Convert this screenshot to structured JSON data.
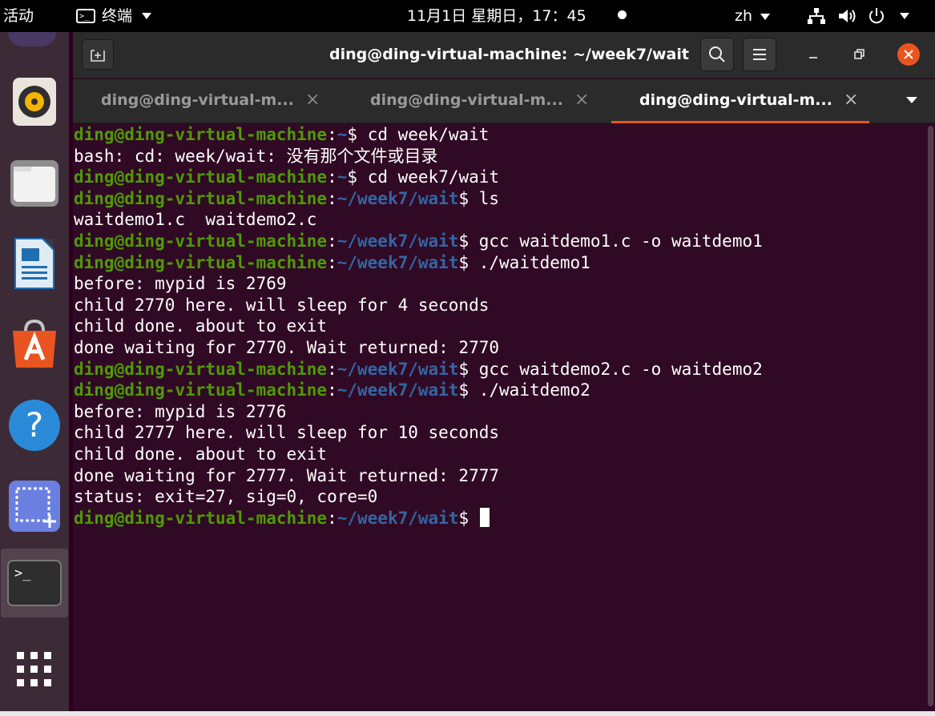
{
  "topbar": {
    "activities": "活动",
    "app_name": "终端",
    "clock": "11月1日 星期日，17：45",
    "language": "zh"
  },
  "dock": {
    "items": [
      "rhythmbox-icon",
      "files-icon",
      "libreoffice-writer-icon",
      "ubuntu-software-icon",
      "help-icon",
      "screenshot-icon",
      "terminal-icon",
      "show-apps-icon"
    ]
  },
  "window": {
    "title": "ding@ding-virtual-machine: ~/week7/wait",
    "tabs": [
      {
        "label": "ding@ding-virtual-m...",
        "close": "×",
        "active": false
      },
      {
        "label": "ding@ding-virtual-m...",
        "close": "×",
        "active": false
      },
      {
        "label": "ding@ding-virtual-m...",
        "close": "×",
        "active": true
      }
    ]
  },
  "terminal": {
    "lines": [
      {
        "type": "prompt",
        "user": "ding@ding-virtual-machine",
        "path": "~",
        "cmd": " cd week/wait"
      },
      {
        "type": "output",
        "text": "bash: cd: week/wait: 没有那个文件或目录"
      },
      {
        "type": "prompt",
        "user": "ding@ding-virtual-machine",
        "path": "~",
        "cmd": " cd week7/wait"
      },
      {
        "type": "prompt",
        "user": "ding@ding-virtual-machine",
        "path": "~/week7/wait",
        "cmd": " ls"
      },
      {
        "type": "output",
        "text": "waitdemo1.c  waitdemo2.c"
      },
      {
        "type": "prompt",
        "user": "ding@ding-virtual-machine",
        "path": "~/week7/wait",
        "cmd": " gcc waitdemo1.c -o waitdemo1"
      },
      {
        "type": "prompt",
        "user": "ding@ding-virtual-machine",
        "path": "~/week7/wait",
        "cmd": " ./waitdemo1"
      },
      {
        "type": "output",
        "text": "before: mypid is 2769"
      },
      {
        "type": "output",
        "text": "child 2770 here. will sleep for 4 seconds"
      },
      {
        "type": "output",
        "text": "child done. about to exit"
      },
      {
        "type": "output",
        "text": "done waiting for 2770. Wait returned: 2770"
      },
      {
        "type": "prompt",
        "user": "ding@ding-virtual-machine",
        "path": "~/week7/wait",
        "cmd": " gcc waitdemo2.c -o waitdemo2"
      },
      {
        "type": "prompt",
        "user": "ding@ding-virtual-machine",
        "path": "~/week7/wait",
        "cmd": " ./waitdemo2"
      },
      {
        "type": "output",
        "text": "before: mypid is 2776"
      },
      {
        "type": "output",
        "text": "child 2777 here. will sleep for 10 seconds"
      },
      {
        "type": "output",
        "text": "child done. about to exit"
      },
      {
        "type": "output",
        "text": "done waiting for 2777. Wait returned: 2777"
      },
      {
        "type": "output",
        "text": "status: exit=27, sig=0, core=0"
      },
      {
        "type": "prompt",
        "user": "ding@ding-virtual-machine",
        "path": "~/week7/wait",
        "cmd": " ",
        "cursor": true
      }
    ],
    "colors": {
      "user": "#4e9a06",
      "path": "#3465a4",
      "background": "#300a24",
      "accent": "#e95420"
    }
  }
}
